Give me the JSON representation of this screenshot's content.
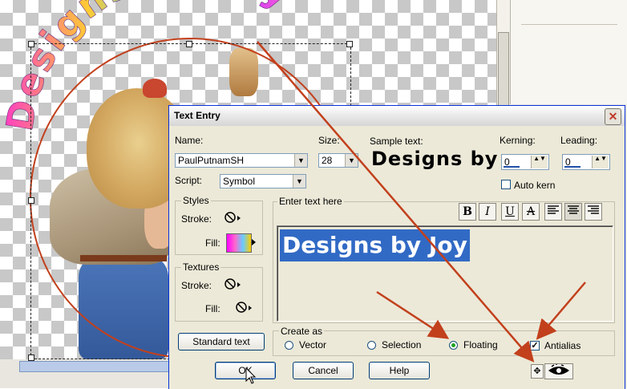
{
  "canvas": {
    "curved_text": "Designs by Joy"
  },
  "dialog": {
    "title": "Text Entry",
    "close_glyph": "✕",
    "name_label": "Name:",
    "name_value": "PaulPutnamSH",
    "size_label": "Size:",
    "size_value": "28",
    "script_label": "Script:",
    "script_value": "Symbol",
    "sample_label": "Sample text:",
    "sample_text": "Designs by",
    "kerning_label": "Kerning:",
    "kerning_value": "0",
    "leading_label": "Leading:",
    "leading_value": "0",
    "auto_kern_label": "Auto kern",
    "auto_kern_checked": false,
    "styles_title": "Styles",
    "stroke_label": "Stroke:",
    "fill_label": "Fill:",
    "textures_title": "Textures",
    "enter_text_label": "Enter text here",
    "entered_text": "Designs by Joy",
    "format_buttons": {
      "bold": "B",
      "italic": "I",
      "underline": "U",
      "strike": "A"
    },
    "standard_text_button": "Standard text",
    "create_as_title": "Create as",
    "create_as_options": [
      "Vector",
      "Selection",
      "Floating"
    ],
    "create_as_selected": "Floating",
    "antialias_label": "Antialias",
    "antialias_checked": true,
    "ok_button": "OK",
    "cancel_button": "Cancel",
    "help_button": "Help"
  },
  "colors": {
    "title_bar": "#d6d6d6",
    "dialog_bg": "#ece9d8",
    "selection_bg": "#316ac5",
    "annotation_arrow": "#c2401c"
  }
}
